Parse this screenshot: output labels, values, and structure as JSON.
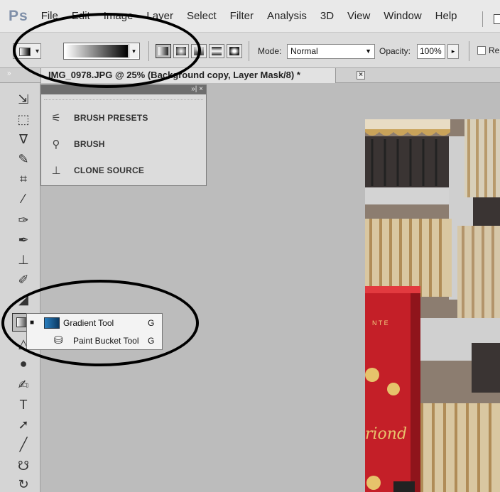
{
  "app": {
    "logo": "Ps"
  },
  "menu": {
    "items": [
      "File",
      "Edit",
      "Image",
      "Layer",
      "Select",
      "Filter",
      "Analysis",
      "3D",
      "View",
      "Window",
      "Help"
    ]
  },
  "options": {
    "mode_label": "Mode:",
    "mode_value": "Normal",
    "opacity_label": "Opacity:",
    "opacity_value": "100%",
    "reverse_label": "Re"
  },
  "document": {
    "tab_title": "IMG_0978.JPG @ 25% (Background copy, Layer Mask/8) *"
  },
  "panel": {
    "items": [
      {
        "label": "BRUSH PRESETS",
        "icon": "brush-presets-icon"
      },
      {
        "label": "BRUSH",
        "icon": "brush-icon"
      },
      {
        "label": "CLONE SOURCE",
        "icon": "clone-source-icon"
      }
    ]
  },
  "flyout": {
    "items": [
      {
        "label": "Gradient Tool",
        "shortcut": "G",
        "selected": true,
        "icon": "gradient-icon"
      },
      {
        "label": "Paint Bucket Tool",
        "shortcut": "G",
        "selected": false,
        "icon": "paint-bucket-icon"
      }
    ]
  },
  "canvas": {
    "sign_text": "riond",
    "sign_letters": "N T E"
  },
  "colors": {
    "accent": "#d32f2f",
    "annotation": "#000000"
  }
}
